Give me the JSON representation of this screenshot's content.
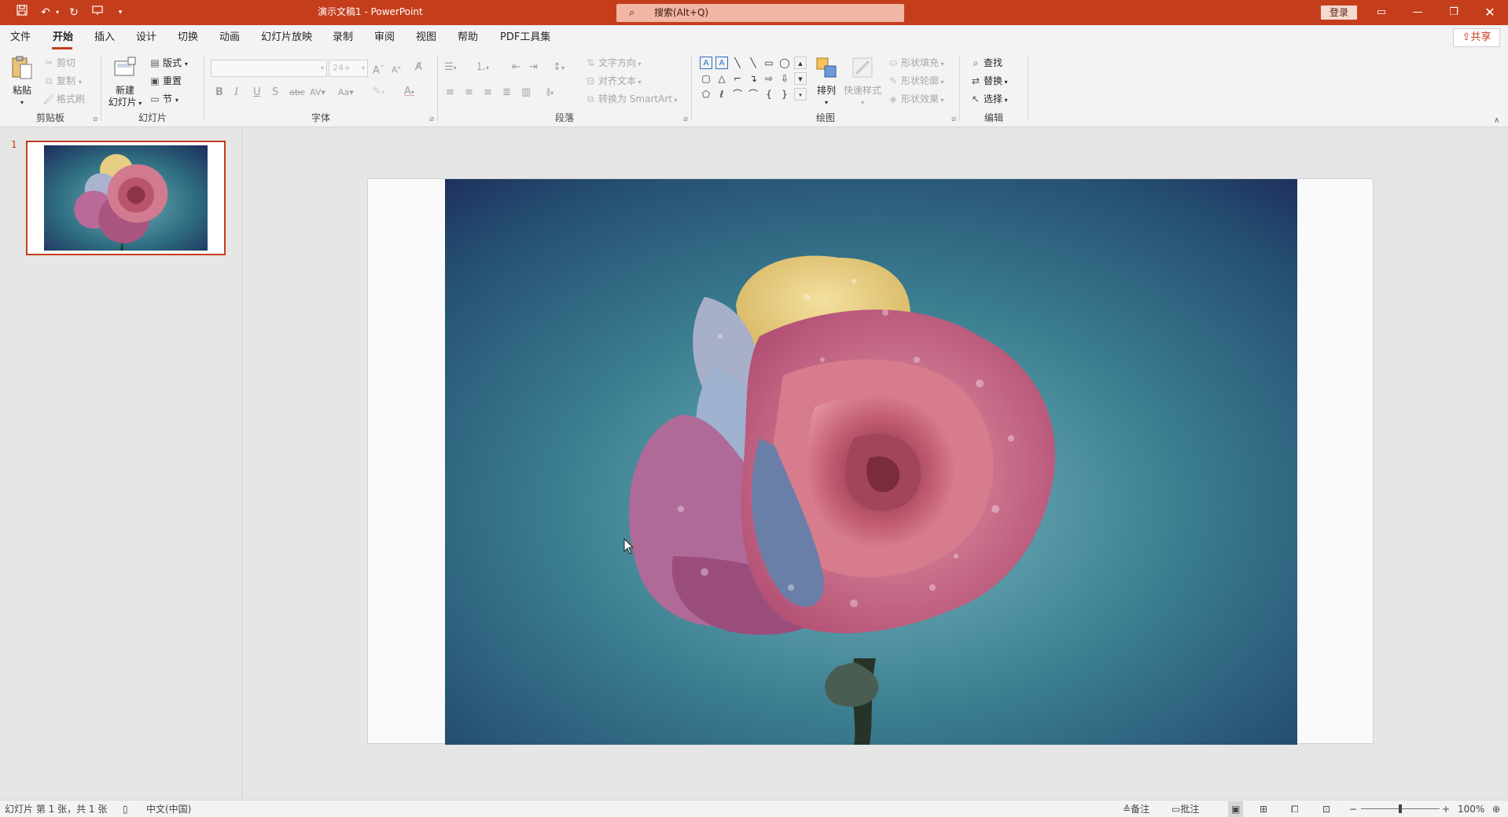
{
  "titlebar": {
    "doc_title": "演示文稿1  -  PowerPoint",
    "search_placeholder": "搜索(Alt+Q)",
    "login_label": "登录"
  },
  "menu": {
    "tabs": [
      "文件",
      "开始",
      "插入",
      "设计",
      "切换",
      "动画",
      "幻灯片放映",
      "录制",
      "审阅",
      "视图",
      "帮助",
      "PDF工具集"
    ],
    "active_tab": "开始",
    "share_label": "共享"
  },
  "ribbon": {
    "clipboard": {
      "paste": "粘贴",
      "cut": "剪切",
      "copy": "复制",
      "format_painter": "格式刷",
      "label": "剪贴板"
    },
    "slides": {
      "new_slide_line1": "新建",
      "new_slide_line2": "幻灯片",
      "layout": "版式",
      "reset": "重置",
      "section": "节",
      "label": "幻灯片"
    },
    "font": {
      "size": "24+",
      "bold": "B",
      "italic": "I",
      "underline": "U",
      "strike": "S",
      "label": "字体"
    },
    "paragraph": {
      "text_direction": "文字方向",
      "align_text": "对齐文本",
      "smartart": "转换为 SmartArt",
      "label": "段落"
    },
    "drawing": {
      "arrange": "排列",
      "quick_styles": "快速样式",
      "shape_fill": "形状填充",
      "shape_outline": "形状轮廓",
      "shape_effects": "形状效果",
      "label": "绘图"
    },
    "editing": {
      "find": "查找",
      "replace": "替换",
      "select": "选择",
      "label": "编辑"
    }
  },
  "thumbnails": {
    "slide_number": "1"
  },
  "statusbar": {
    "slide_info": "幻灯片 第 1 张，共 1 张",
    "language": "中文(中国)",
    "notes": "备注",
    "comments": "批注",
    "zoom": "100%"
  },
  "colors": {
    "accent": "#c43e1c",
    "ribbon_bg": "#f3f3f3",
    "workspace_bg": "#e6e6e6"
  }
}
